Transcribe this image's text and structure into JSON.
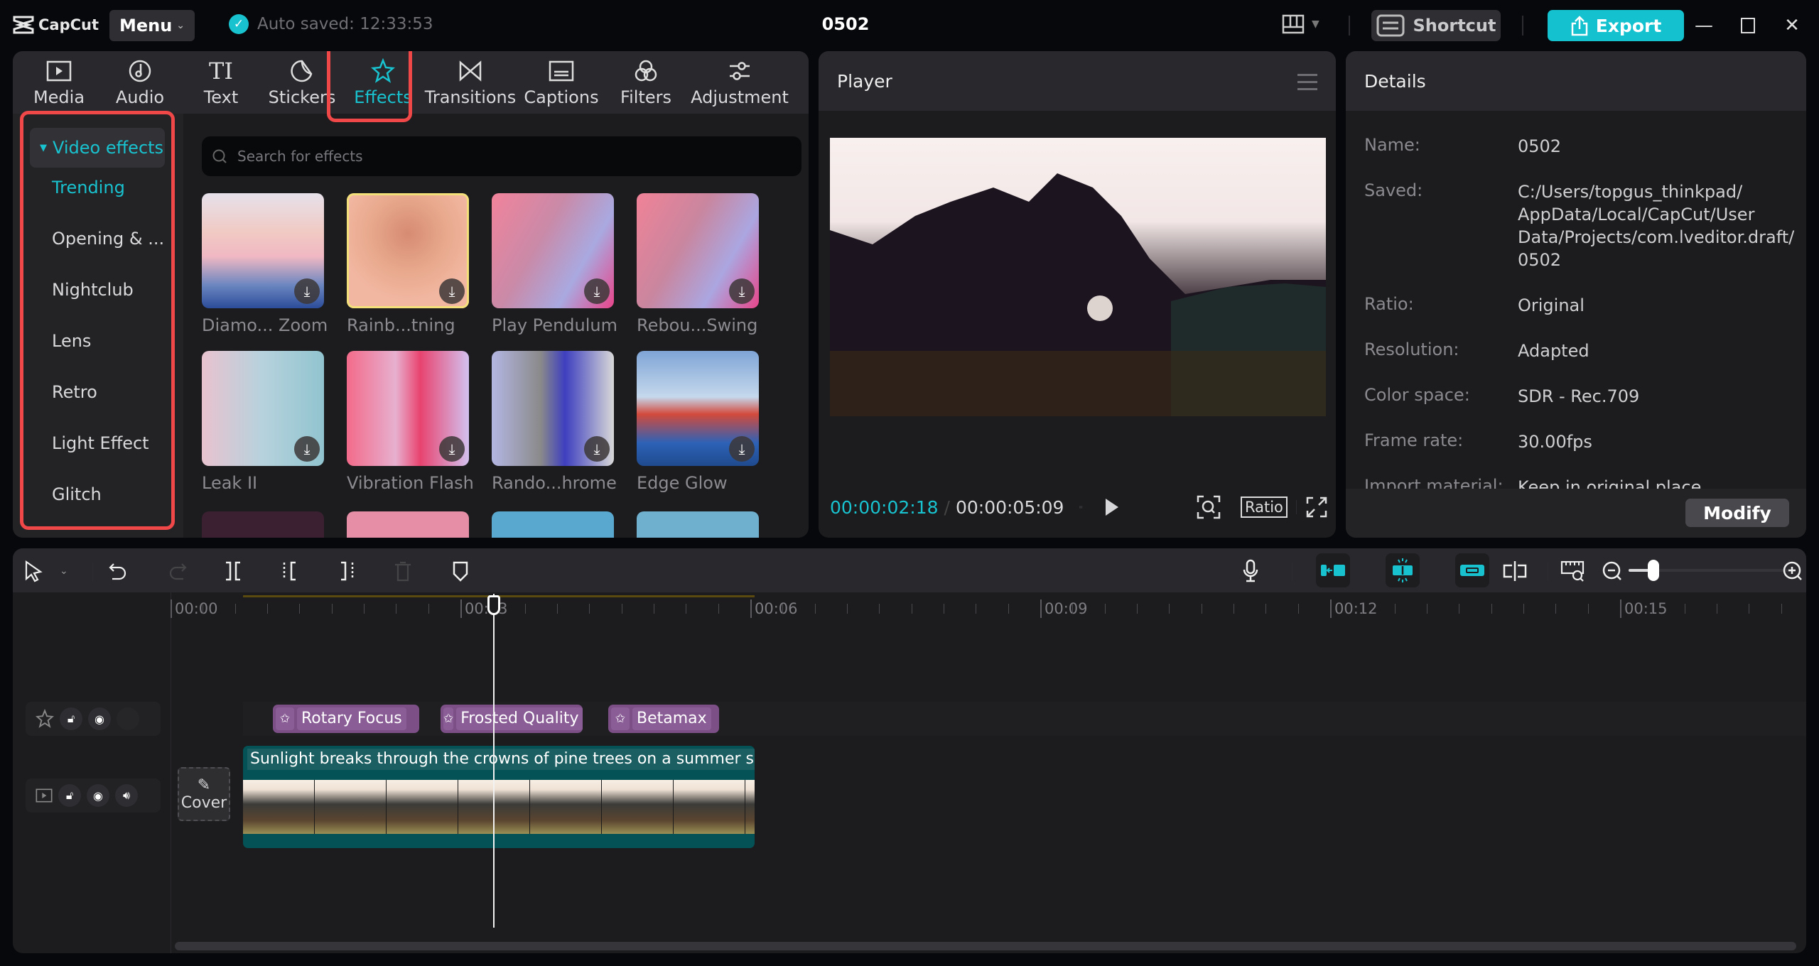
{
  "titlebar": {
    "app_name": "CapCut",
    "menu_label": "Menu",
    "autosave_text": "Auto saved: 12:33:53",
    "project_title": "0502",
    "shortcut_label": "Shortcut",
    "export_label": "Export",
    "accent_color": "#13c1cf"
  },
  "tabs": [
    {
      "label": "Media",
      "icon": "media-icon"
    },
    {
      "label": "Audio",
      "icon": "audio-icon"
    },
    {
      "label": "Text",
      "icon": "text-icon"
    },
    {
      "label": "Stickers",
      "icon": "sticker-icon"
    },
    {
      "label": "Effects",
      "icon": "effects-icon",
      "active": true
    },
    {
      "label": "Transitions",
      "icon": "transitions-icon"
    },
    {
      "label": "Captions",
      "icon": "captions-icon"
    },
    {
      "label": "Filters",
      "icon": "filters-icon"
    },
    {
      "label": "Adjustment",
      "icon": "adjustment-icon"
    }
  ],
  "sidebar": {
    "header": "Video effects",
    "items": [
      {
        "label": "Trending",
        "active": true
      },
      {
        "label": "Opening & ..."
      },
      {
        "label": "Nightclub"
      },
      {
        "label": "Lens"
      },
      {
        "label": "Retro"
      },
      {
        "label": "Light Effect"
      },
      {
        "label": "Glitch"
      }
    ]
  },
  "search": {
    "placeholder": "Search for effects"
  },
  "effects": [
    {
      "label": "Diamo... Zoom"
    },
    {
      "label": "Rainb...tning"
    },
    {
      "label": "Play Pendulum"
    },
    {
      "label": "Rebou...Swing"
    },
    {
      "label": "Leak II"
    },
    {
      "label": "Vibration Flash"
    },
    {
      "label": "Rando...hrome"
    },
    {
      "label": "Edge Glow"
    }
  ],
  "player": {
    "title": "Player",
    "current_time": "00:00:02:18",
    "separator": "/",
    "total_time": "00:00:05:09",
    "ratio_label": "Ratio"
  },
  "details": {
    "title": "Details",
    "rows": [
      {
        "label": "Name:",
        "value": "0502"
      },
      {
        "label": "Saved:",
        "value": "C:/Users/topgus_thinkpad/ AppData/Local/CapCut/User Data/Projects/com.lveditor.draft/ 0502"
      },
      {
        "label": "Ratio:",
        "value": "Original"
      },
      {
        "label": "Resolution:",
        "value": "Adapted"
      },
      {
        "label": "Color space:",
        "value": "SDR - Rec.709"
      },
      {
        "label": "Frame rate:",
        "value": "30.00fps"
      },
      {
        "label": "Import material:",
        "value": "Keep in original place"
      }
    ],
    "modify_label": "Modify"
  },
  "timeline": {
    "ruler_labels": [
      "00:00",
      "00:03",
      "00:06",
      "00:09",
      "00:12",
      "00:15"
    ],
    "effect_clips": [
      "Rotary Focus",
      "Frosted Quality",
      "Betamax"
    ],
    "video_clip_title": "Sunlight breaks through the crowns of pine trees on a summer sunrise",
    "cover_label": "Cover",
    "zoom_level": 0.15,
    "effect_clip_color": "#7c4f87",
    "video_clip_color": "#045255"
  }
}
